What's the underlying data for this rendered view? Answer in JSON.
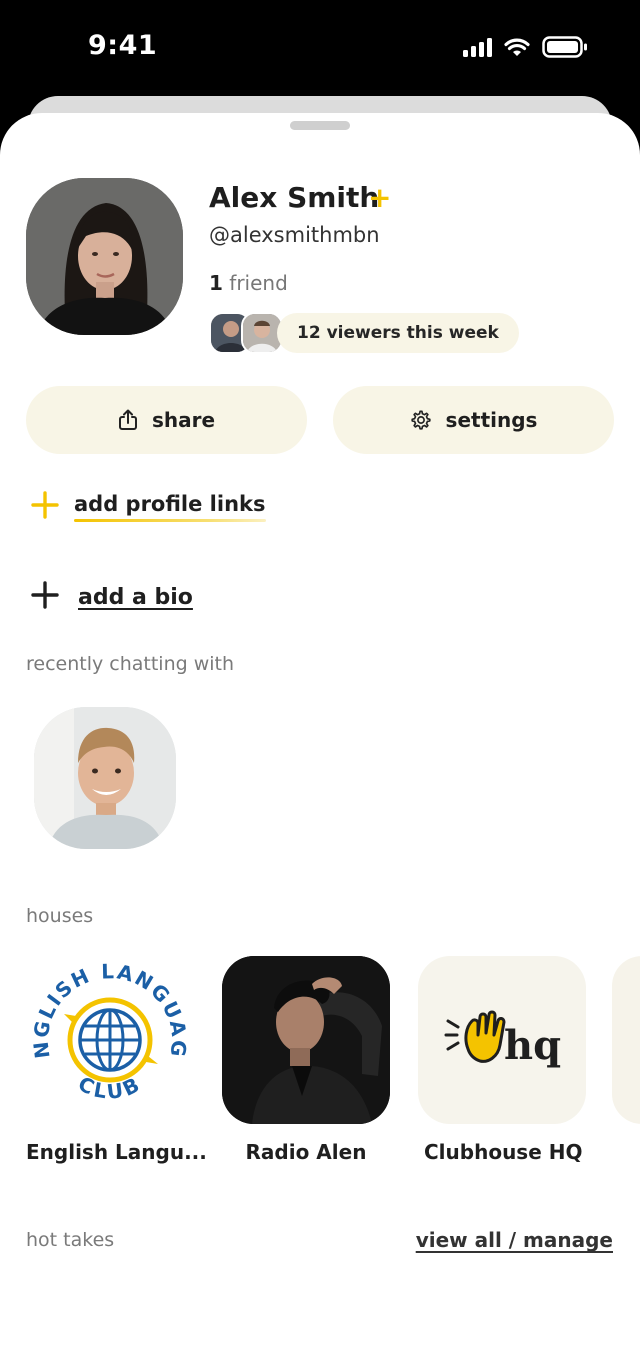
{
  "status_bar": {
    "time": "9:41"
  },
  "profile": {
    "name": "Alex Smith",
    "plus_badge": "+",
    "username": "@alexsmithmbn",
    "friends_count": "1",
    "friends_label": "friend",
    "viewers_label": "12 viewers this week"
  },
  "actions": {
    "share_label": "share",
    "settings_label": "settings"
  },
  "links": {
    "add_links_label": "add profile links",
    "add_bio_label": "add a bio"
  },
  "recent": {
    "title": "recently chatting with"
  },
  "houses": {
    "title": "houses",
    "items": [
      {
        "name": "English Langu...",
        "logo_top": "ENGLISH LANGUAGE",
        "logo_bottom": "CLUB"
      },
      {
        "name": "Radio Alen"
      },
      {
        "name": "Clubhouse HQ",
        "logo_text": "hq"
      }
    ]
  },
  "hot_takes": {
    "title": "hot takes",
    "view_all_label": "view all / manage"
  },
  "colors": {
    "accent_yellow": "#f4c300",
    "pill_bg": "#f8f5e6",
    "logo_blue": "#1b5fa6"
  }
}
